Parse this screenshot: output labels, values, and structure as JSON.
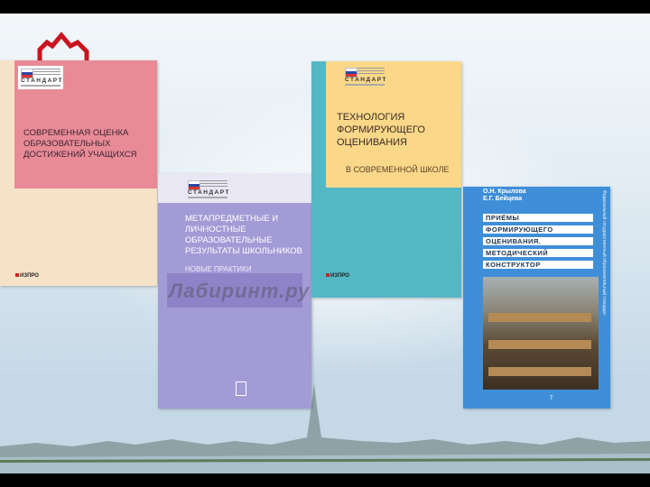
{
  "books": [
    {
      "standard_label": "СТАНДАРТ",
      "title": "СОВРЕМЕННАЯ ОЦЕНКА ОБРАЗОВАТЕЛЬНЫХ ДОСТИЖЕНИЙ УЧАЩИХСЯ",
      "publisher": "ИЗПРО"
    },
    {
      "standard_label": "СТАНДАРТ",
      "title": "МЕТАПРЕДМЕТНЫЕ И ЛИЧНОСТНЫЕ ОБРАЗОВАТЕЛЬНЫЕ РЕЗУЛЬТАТЫ ШКОЛЬНИКОВ",
      "subtitle": "НОВЫЕ ПРАКТИКИ"
    },
    {
      "standard_label": "СТАНДАРТ",
      "title": "ТЕХНОЛОГИЯ ФОРМИРУЮЩЕГО ОЦЕНИВАНИЯ",
      "subtitle": "В СОВРЕМЕННОЙ ШКОЛЕ",
      "publisher": "ИЗПРО"
    },
    {
      "authors": [
        "О.Н. Крылова",
        "Е.Г. Бейцева"
      ],
      "title_lines": [
        "ПРИЁМЫ",
        "ФОРМИРУЮЩЕГО",
        "ОЦЕНИВАНИЯ.",
        "МЕТОДИЧЕСКИЙ",
        "КОНСТРУКТОР"
      ],
      "spine_text": "Федеральный государственный образовательный стандарт"
    }
  ],
  "watermark": "Лабиринт.ру"
}
